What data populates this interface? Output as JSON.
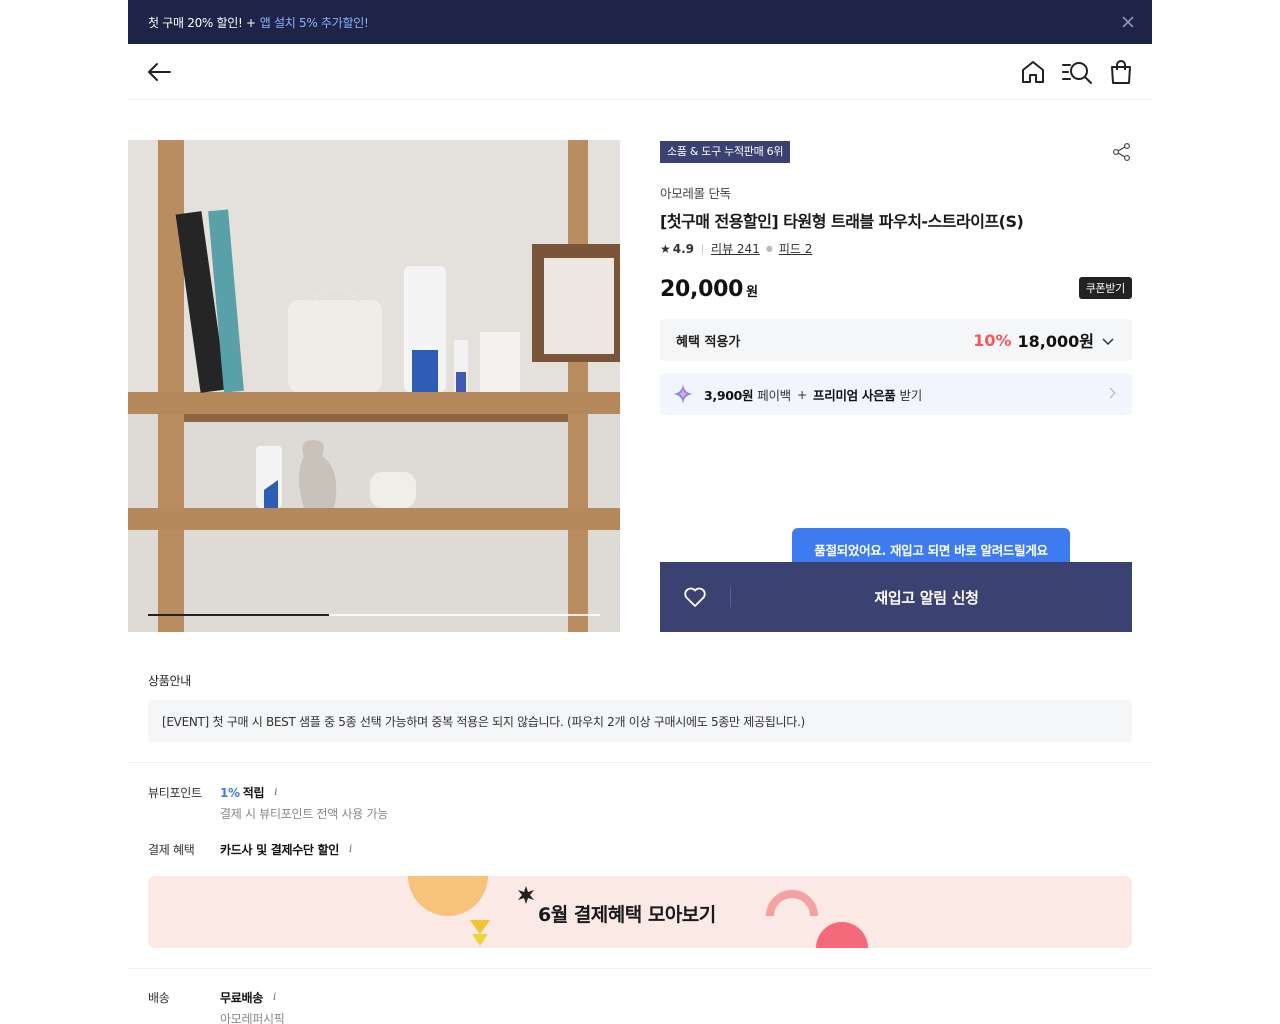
{
  "promo": {
    "text": "첫 구매 20% 할인! +",
    "highlight": "앱 설치 5% 추가할인!"
  },
  "header": {
    "icons": [
      "back-arrow-icon",
      "home-icon",
      "category-search-icon",
      "shopping-bag-icon"
    ]
  },
  "gallery": {
    "progress": 0.4
  },
  "product": {
    "rank_badge": "소품 & 도구 누적판매 6위",
    "brand": "아모레몰 단독",
    "title": "[첫구매 전용할인] 타원형 트래블 파우치-스트라이프(S)",
    "rating": "4.9",
    "review_label": "리뷰 241",
    "feed_label": "피드 2",
    "price": "20,000",
    "price_unit": "원",
    "coupon_label": "쿠폰받기",
    "benefit_label": "혜택 적용가",
    "discount_pct": "10%",
    "sale_price": "18,000원",
    "payback_amount": "3,900원",
    "payback_word": "페이백",
    "plus": "+",
    "gift_label": "프리미엄 사은품",
    "gift_suffix": "받기"
  },
  "restock": {
    "tooltip": "품절되었어요. 재입고 되면 바로 알려드릴게요",
    "button": "재입고 알림 신청"
  },
  "notice": {
    "title": "상품안내",
    "text": "[EVENT] 첫 구매 시 BEST 샘플 중 5종 선택 가능하며 중복 적용은 되지 않습니다. (파우치 2개 이상 구매시에도 5종만 제공됩니다.)"
  },
  "beauty_point": {
    "label": "뷰티포인트",
    "pct": "1%",
    "value": "적립",
    "info": "i",
    "sub": "결제 시 뷰티포인트 전액 사용 가능"
  },
  "payment": {
    "label": "결제 혜택",
    "value": "카드사 및 결제수단 할인",
    "info": "i"
  },
  "banner": {
    "text": "6월 결제혜택 모아보기"
  },
  "delivery": {
    "label": "배송",
    "value": "무료배송",
    "info": "i",
    "sub": "아모레퍼시픽"
  },
  "colors": {
    "navy": "#1e2447",
    "button": "#3b4170",
    "accent_red": "#f25a5a",
    "accent_blue": "#3d7cf0"
  }
}
